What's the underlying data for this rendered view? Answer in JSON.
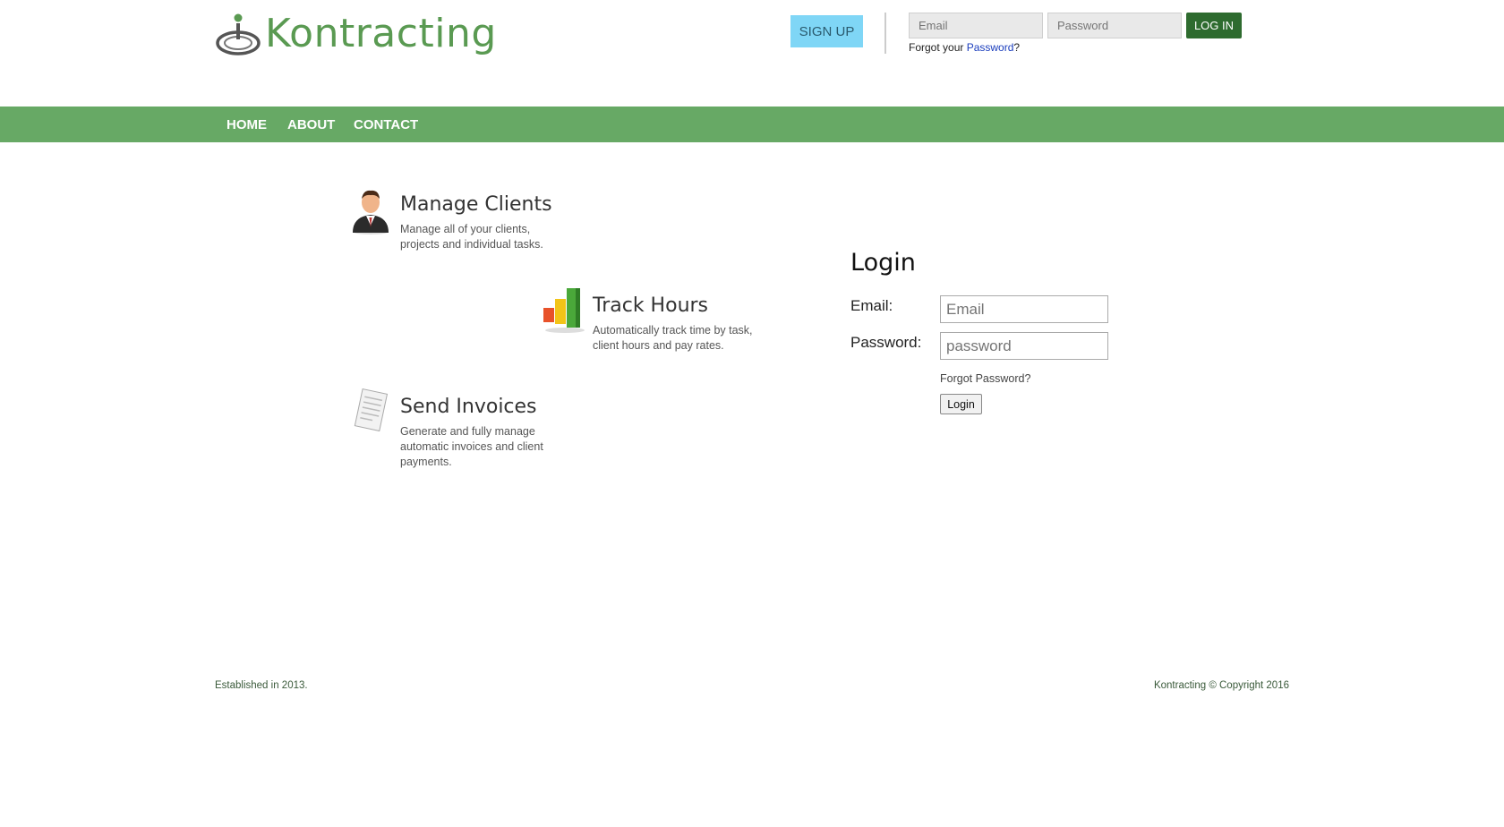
{
  "header": {
    "brand": "Kontracting",
    "signup_label": "SIGN UP",
    "email_placeholder": "Email",
    "password_placeholder": "Password",
    "login_label": "LOG IN",
    "forgot_prefix": "Forgot your ",
    "forgot_link": "Password",
    "forgot_suffix": "?"
  },
  "nav": {
    "items": [
      {
        "label": "HOME"
      },
      {
        "label": "ABOUT"
      },
      {
        "label": "CONTACT"
      }
    ]
  },
  "features": [
    {
      "title": "Manage Clients",
      "desc_line1": "Manage all of your clients,",
      "desc_line2": "projects and individual tasks.",
      "icon": "businessman-icon"
    },
    {
      "title": "Track Hours",
      "desc_line1": "Automatically track time by task,",
      "desc_line2": "client hours and pay rates.",
      "icon": "bar-chart-icon"
    },
    {
      "title": "Send Invoices",
      "desc_line1": "Generate and fully manage",
      "desc_line2": "automatic invoices and client",
      "desc_line3": "payments.",
      "icon": "invoice-icon"
    }
  ],
  "login_form": {
    "heading": "Login",
    "email_label": "Email:",
    "email_placeholder": "Email",
    "password_label": "Password:",
    "password_placeholder": "password",
    "forgot_label": "Forgot Password?",
    "submit_label": "Login"
  },
  "footer": {
    "left": "Established in 2013.",
    "right": "Kontracting © Copyright 2016"
  },
  "colors": {
    "nav_green": "#67a965",
    "brand_green": "#5a9a52",
    "signup_blue": "#7fd6f6",
    "login_dark_green": "#2e6b2f",
    "link_blue": "#1a3dbd"
  }
}
